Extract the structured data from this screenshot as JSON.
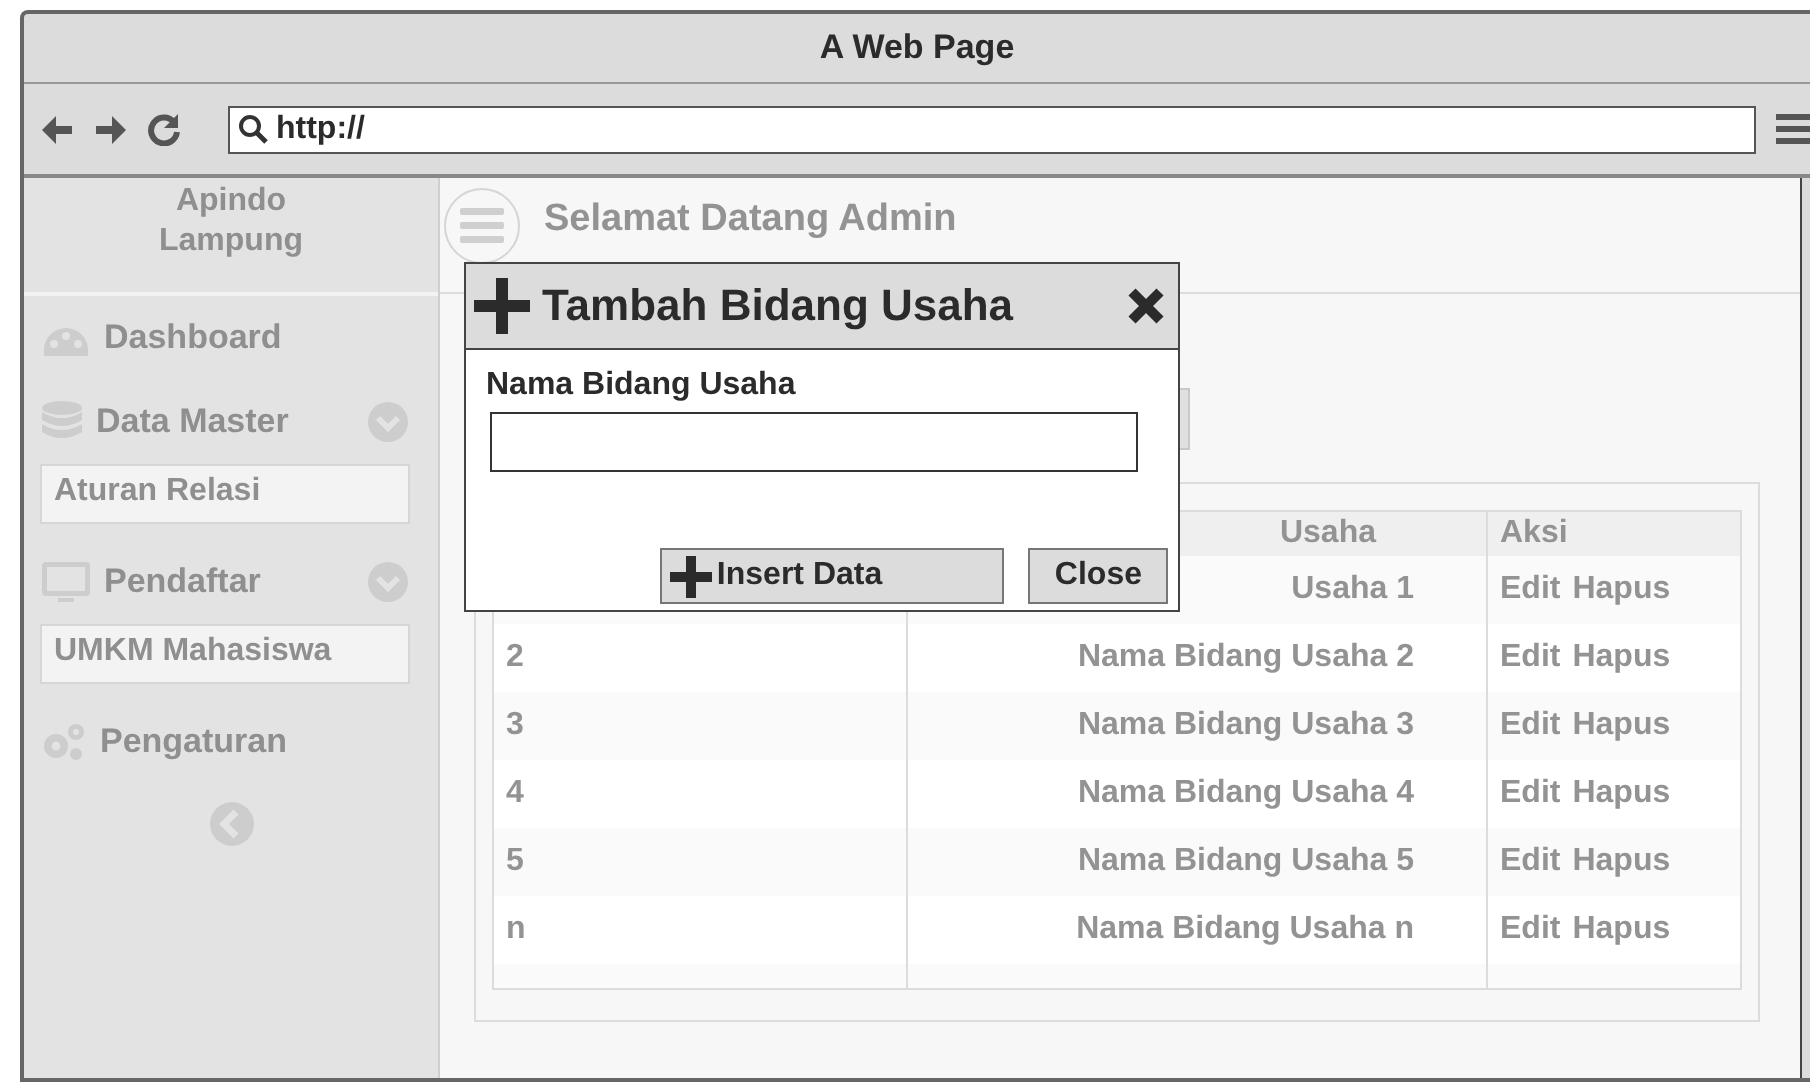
{
  "window": {
    "title": "A Web Page"
  },
  "toolbar": {
    "url": "http://"
  },
  "sidebar": {
    "brand": "Apindo Lampung",
    "items": [
      {
        "kind": "link",
        "label": "Dashboard"
      },
      {
        "kind": "group",
        "label": "Data Master",
        "expanded": true,
        "children": [
          {
            "label": "Aturan Relasi"
          }
        ]
      },
      {
        "kind": "group",
        "label": "Pendaftar",
        "expanded": true,
        "children": [
          {
            "label": "UMKM Mahasiswa"
          }
        ]
      },
      {
        "kind": "link",
        "label": "Pengaturan"
      }
    ]
  },
  "header": {
    "title": "Selamat Datang Admin"
  },
  "table": {
    "columns": [
      "Usaha",
      "Aksi"
    ],
    "rows": [
      {
        "name": "Usaha 1",
        "actions": [
          "Edit",
          "Hapus"
        ]
      },
      {
        "no": "2",
        "name": "Nama Bidang Usaha 2",
        "actions": [
          "Edit",
          "Hapus"
        ]
      },
      {
        "no": "3",
        "name": "Nama Bidang Usaha 3",
        "actions": [
          "Edit",
          "Hapus"
        ]
      },
      {
        "no": "4",
        "name": "Nama Bidang Usaha 4",
        "actions": [
          "Edit",
          "Hapus"
        ]
      },
      {
        "no": "5",
        "name": "Nama Bidang Usaha 5",
        "actions": [
          "Edit",
          "Hapus"
        ]
      },
      {
        "no": "n",
        "name": "Nama Bidang Usaha n",
        "actions": [
          "Edit",
          "Hapus"
        ]
      }
    ]
  },
  "dialog": {
    "title": "Tambah Bidang Usaha",
    "field_label": "Nama Bidang Usaha",
    "buttons": [
      {
        "kind": "insert",
        "label": "Insert Data"
      },
      {
        "kind": "close",
        "label": "Close"
      }
    ]
  }
}
